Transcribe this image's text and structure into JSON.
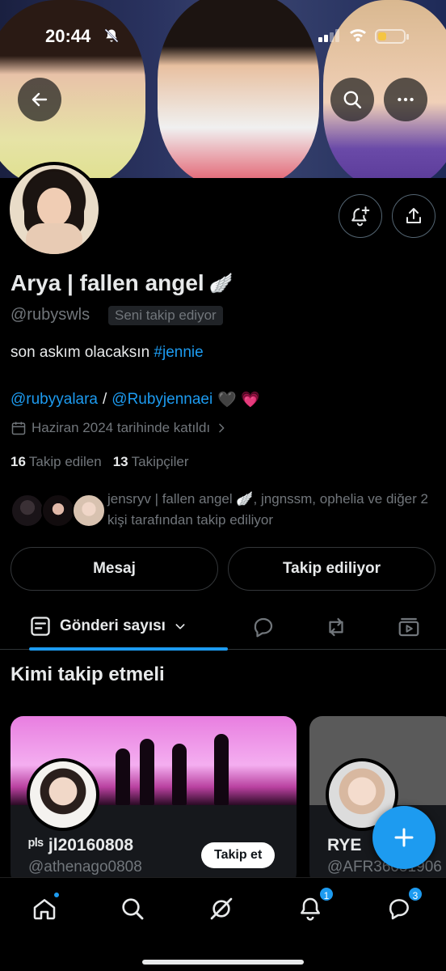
{
  "status_bar": {
    "time": "20:44"
  },
  "header": {
    "back_icon": "arrow-left-icon",
    "search_icon": "search-icon",
    "more_icon": "more-horizontal-icon"
  },
  "profile": {
    "display_name": "Arya | fallen angel",
    "name_emoji": "🪽",
    "handle": "@rubyswls",
    "follows_you": "Seni takip ediyor",
    "bio_text": "son askım olacaksın ",
    "bio_hashtag": "#jennie",
    "link1": "@rubyyalara",
    "link_sep": " / ",
    "link2": "@Rubyjennaei",
    "links_emoji": "🖤 💗",
    "joined": "Haziran 2024 tarihinde katıldı",
    "following_count": "16",
    "following_label": "Takip edilen",
    "followers_count": "13",
    "followers_label": "Takipçiler",
    "mutuals_text": "jensryv | fallen angel 🪽, jngnssm, ophelia ve diğer 2 kişi tarafından takip ediliyor",
    "message_button": "Mesaj",
    "following_button": "Takip ediliyor"
  },
  "tabs": {
    "posts_label": "Gönderi sayısı"
  },
  "who_to_follow": {
    "title": "Kimi takip etmeli",
    "cards": [
      {
        "name": "ᵖˡˢ jl20160808",
        "handle": "@athenago0808",
        "follow_label": "Takip et"
      },
      {
        "name": "RYE",
        "handle": "@AFR36051906"
      }
    ]
  },
  "bottom_nav": {
    "notifications_badge": "1",
    "messages_badge": "3"
  },
  "colors": {
    "accent": "#1d9bf0",
    "background": "#000000",
    "secondary_text": "#71767b"
  }
}
